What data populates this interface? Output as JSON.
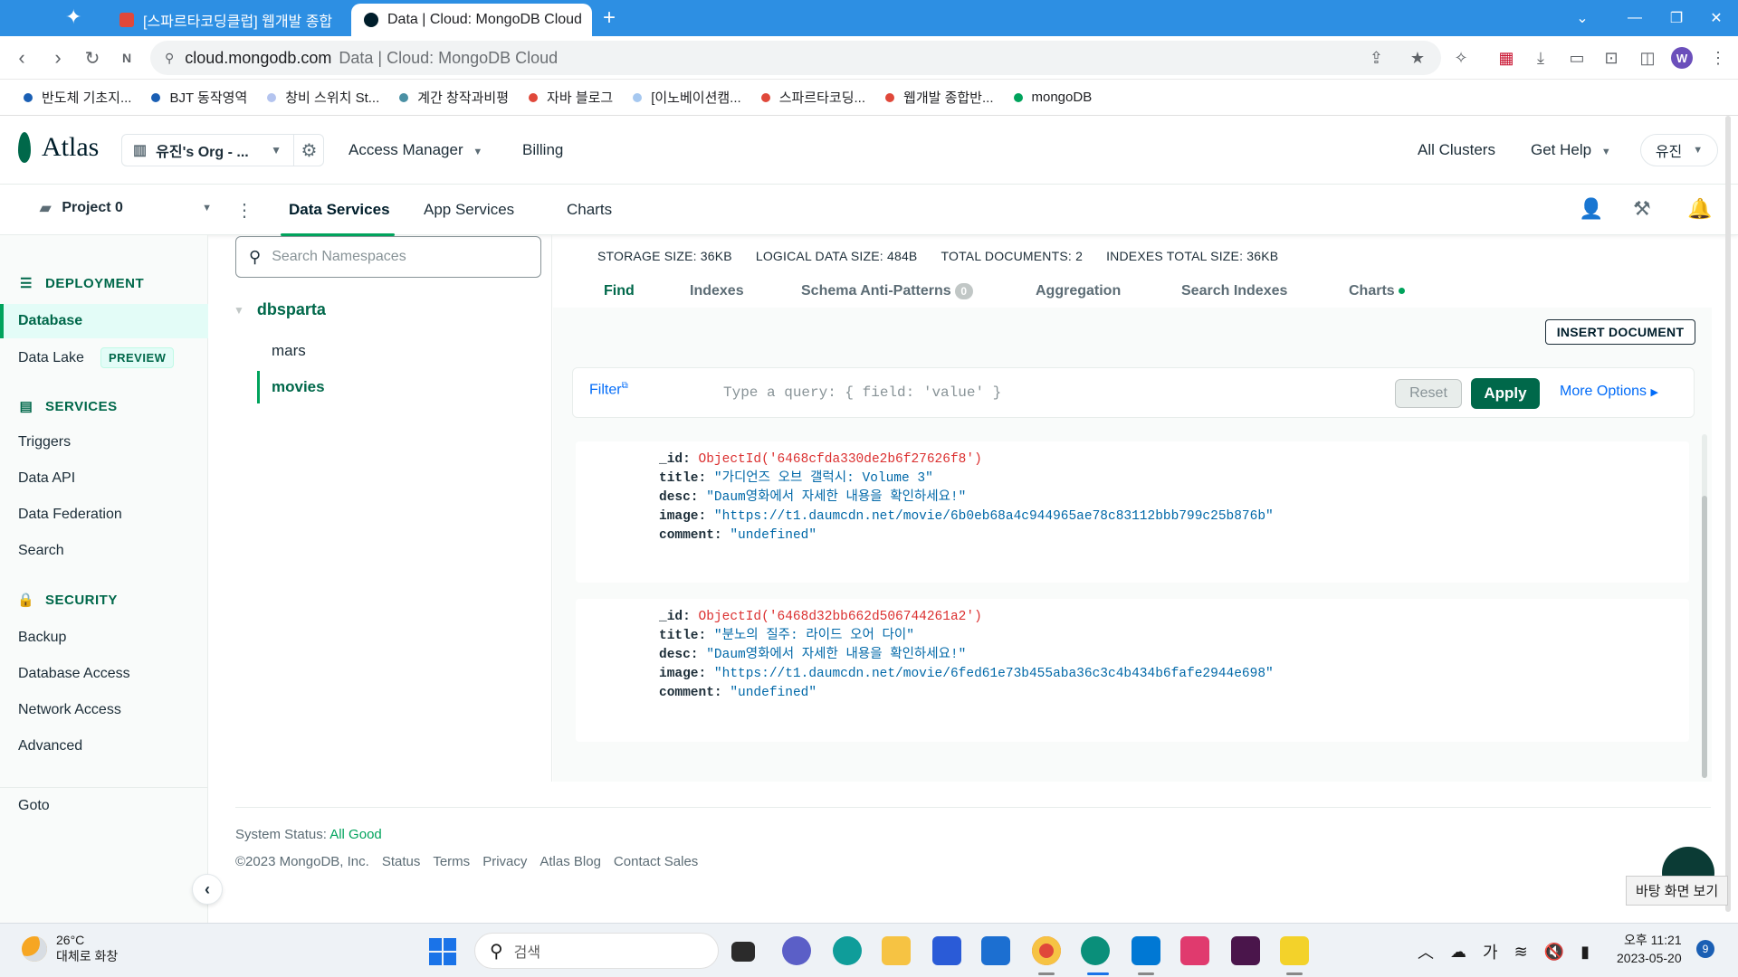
{
  "browser": {
    "tabs": [
      {
        "title": "[스파르타코딩클럽] 웹개발 종합",
        "active": false
      },
      {
        "title": "Data | Cloud: MongoDB Cloud",
        "active": true
      }
    ],
    "new_tab": "+",
    "address_host": "cloud.mongodb.com",
    "address_rest": "Data | Cloud: MongoDB Cloud",
    "profile_initial": "W",
    "bookmarks": [
      {
        "label": "반도체 기초지...",
        "color": "#1a5fb4"
      },
      {
        "label": "BJT 동작영역",
        "color": "#1a5fb4"
      },
      {
        "label": "창비 스위치 St...",
        "color": "#b4c4ef"
      },
      {
        "label": "계간 창작과비평",
        "color": "#4a90a4"
      },
      {
        "label": "자바 블로그",
        "color": "#e0483a"
      },
      {
        "label": "[이노베이션캠...",
        "color": "#a6c8f0"
      },
      {
        "label": "스파르타코딩...",
        "color": "#e0483a"
      },
      {
        "label": "웹개발 종합반...",
        "color": "#e0483a"
      },
      {
        "label": "mongoDB",
        "color": "#00a35c"
      }
    ]
  },
  "atlas": {
    "logo": "Atlas",
    "org": "유진's Org - ...",
    "header_links": {
      "access_manager": "Access Manager",
      "billing": "Billing"
    },
    "right_links": {
      "all_clusters": "All Clusters",
      "get_help": "Get Help",
      "user": "유진"
    },
    "project": "Project 0",
    "project_tabs": [
      "Data Services",
      "App Services",
      "Charts"
    ]
  },
  "leftnav": {
    "deployment": "DEPLOYMENT",
    "database": "Database",
    "data_lake": "Data Lake",
    "preview": "PREVIEW",
    "services": "SERVICES",
    "services_items": [
      "Triggers",
      "Data API",
      "Data Federation",
      "Search"
    ],
    "security": "SECURITY",
    "security_items": [
      "Backup",
      "Database Access",
      "Network Access",
      "Advanced"
    ],
    "goto": "Goto"
  },
  "namespaces": {
    "search_placeholder": "Search Namespaces",
    "database": "dbsparta",
    "collections": [
      "mars",
      "movies"
    ],
    "active_collection": "movies"
  },
  "stats": {
    "storage": "STORAGE SIZE: 36KB",
    "logical": "LOGICAL DATA SIZE: 484B",
    "total_docs": "TOTAL DOCUMENTS: 2",
    "indexes": "INDEXES TOTAL SIZE: 36KB"
  },
  "collection_tabs": {
    "find": "Find",
    "indexes": "Indexes",
    "schema": "Schema Anti-Patterns",
    "schema_count": "0",
    "aggregation": "Aggregation",
    "search_indexes": "Search Indexes",
    "charts": "Charts"
  },
  "toolbar": {
    "insert_document": "INSERT DOCUMENT",
    "filter_label": "Filter",
    "filter_placeholder": "Type a query: { field: 'value' }",
    "reset": "Reset",
    "apply": "Apply",
    "more_options": "More Options"
  },
  "documents": [
    {
      "id": "ObjectId('6468cfda330de2b6f27626f8')",
      "title": "\"가디언즈 오브 갤럭시: Volume 3\"",
      "desc": "\"Daum영화에서 자세한 내용을 확인하세요!\"",
      "image": "\"https://t1.daumcdn.net/movie/6b0eb68a4c944965ae78c83112bbb799c25b876b\"",
      "comment": "\"undefined\""
    },
    {
      "id": "ObjectId('6468d32bb662d506744261a2')",
      "title": "\"분노의 질주: 라이드 오어 다이\"",
      "desc": "\"Daum영화에서 자세한 내용을 확인하세요!\"",
      "image": "\"https://t1.daumcdn.net/movie/6fed61e73b455aba36c3c4b434b6fafe2944e698\"",
      "comment": "\"undefined\""
    }
  ],
  "footer": {
    "status_label": "System Status:",
    "status_value": "All Good",
    "links": [
      "©2023 MongoDB, Inc.",
      "Status",
      "Terms",
      "Privacy",
      "Atlas Blog",
      "Contact Sales"
    ],
    "desktop_tip": "바탕 화면 보기"
  },
  "taskbar": {
    "temp": "26°C",
    "weather": "대체로 화창",
    "search": "검색",
    "ime": "가",
    "time": "오후 11:21",
    "date": "2023-05-20",
    "notifications": "9"
  },
  "colors": {
    "brand_green": "#00684a",
    "accent_green": "#00a35c",
    "link_blue": "#016bf8",
    "chrome_blue": "#2d8fe3"
  }
}
